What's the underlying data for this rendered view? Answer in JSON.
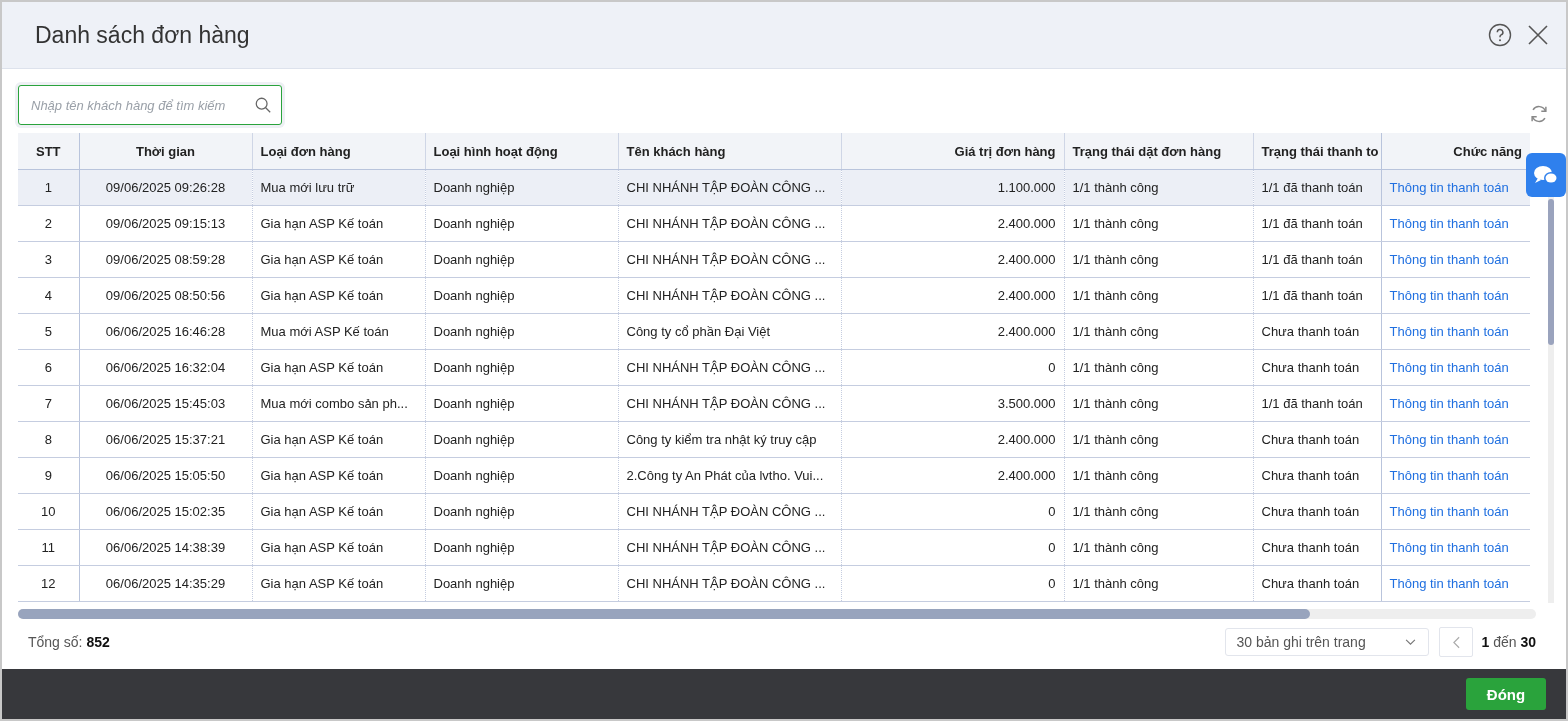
{
  "dialog": {
    "title": "Danh sách đơn hàng"
  },
  "search": {
    "placeholder": "Nhập tên khách hàng để tìm kiếm"
  },
  "table": {
    "columns": [
      "STT",
      "Thời gian",
      "Loại đơn hàng",
      "Loại hình hoạt động",
      "Tên khách hàng",
      "Giá trị đơn hàng",
      "Trạng thái dặt đơn hàng",
      "Trạng thái thanh to",
      "Chức năng"
    ],
    "rows": [
      {
        "selected": true,
        "cells": [
          "1",
          "09/06/2025 09:26:28",
          "Mua mới lưu trữ",
          "Doanh nghiệp",
          "CHI NHÁNH TẬP ĐOÀN CÔNG ...",
          "1.100.000",
          "1/1 thành công",
          "1/1 đã thanh toán",
          "Thông tin thanh toán"
        ]
      },
      {
        "selected": false,
        "cells": [
          "2",
          "09/06/2025 09:15:13",
          "Gia hạn ASP Kế toán",
          "Doanh nghiệp",
          "CHI NHÁNH TẬP ĐOÀN CÔNG ...",
          "2.400.000",
          "1/1 thành công",
          "1/1 đã thanh toán",
          "Thông tin thanh toán"
        ]
      },
      {
        "selected": false,
        "cells": [
          "3",
          "09/06/2025 08:59:28",
          "Gia hạn ASP Kế toán",
          "Doanh nghiệp",
          "CHI NHÁNH TẬP ĐOÀN CÔNG ...",
          "2.400.000",
          "1/1 thành công",
          "1/1 đã thanh toán",
          "Thông tin thanh toán"
        ]
      },
      {
        "selected": false,
        "cells": [
          "4",
          "09/06/2025 08:50:56",
          "Gia hạn ASP Kế toán",
          "Doanh nghiệp",
          "CHI NHÁNH TẬP ĐOÀN CÔNG ...",
          "2.400.000",
          "1/1 thành công",
          "1/1 đã thanh toán",
          "Thông tin thanh toán"
        ]
      },
      {
        "selected": false,
        "cells": [
          "5",
          "06/06/2025 16:46:28",
          "Mua mới ASP Kế toán",
          "Doanh nghiệp",
          "Công ty cổ phần Đại Việt",
          "2.400.000",
          "1/1 thành công",
          "Chưa thanh toán",
          "Thông tin thanh toán"
        ]
      },
      {
        "selected": false,
        "cells": [
          "6",
          "06/06/2025 16:32:04",
          "Gia hạn ASP Kế toán",
          "Doanh nghiệp",
          "CHI NHÁNH TẬP ĐOÀN CÔNG ...",
          "0",
          "1/1 thành công",
          "Chưa thanh toán",
          "Thông tin thanh toán"
        ]
      },
      {
        "selected": false,
        "cells": [
          "7",
          "06/06/2025 15:45:03",
          "Mua mới combo sản ph...",
          "Doanh nghiệp",
          "CHI NHÁNH TẬP ĐOÀN CÔNG ...",
          "3.500.000",
          "1/1 thành công",
          "1/1 đã thanh toán",
          "Thông tin thanh toán"
        ]
      },
      {
        "selected": false,
        "cells": [
          "8",
          "06/06/2025 15:37:21",
          "Gia hạn ASP Kế toán",
          "Doanh nghiệp",
          "Công ty kiểm tra nhật ký truy cập",
          "2.400.000",
          "1/1 thành công",
          "Chưa thanh toán",
          "Thông tin thanh toán"
        ]
      },
      {
        "selected": false,
        "cells": [
          "9",
          "06/06/2025 15:05:50",
          "Gia hạn ASP Kế toán",
          "Doanh nghiệp",
          "2.Công ty An Phát của lvtho. Vui...",
          "2.400.000",
          "1/1 thành công",
          "Chưa thanh toán",
          "Thông tin thanh toán"
        ]
      },
      {
        "selected": false,
        "cells": [
          "10",
          "06/06/2025 15:02:35",
          "Gia hạn ASP Kế toán",
          "Doanh nghiệp",
          "CHI NHÁNH TẬP ĐOÀN CÔNG ...",
          "0",
          "1/1 thành công",
          "Chưa thanh toán",
          "Thông tin thanh toán"
        ]
      },
      {
        "selected": false,
        "cells": [
          "11",
          "06/06/2025 14:38:39",
          "Gia hạn ASP Kế toán",
          "Doanh nghiệp",
          "CHI NHÁNH TẬP ĐOÀN CÔNG ...",
          "0",
          "1/1 thành công",
          "Chưa thanh toán",
          "Thông tin thanh toán"
        ]
      },
      {
        "selected": false,
        "cells": [
          "12",
          "06/06/2025 14:35:29",
          "Gia hạn ASP Kế toán",
          "Doanh nghiệp",
          "CHI NHÁNH TẬP ĐOÀN CÔNG ...",
          "0",
          "1/1 thành công",
          "Chưa thanh toán",
          "Thông tin thanh toán"
        ]
      }
    ]
  },
  "footer": {
    "total_label": "Tổng số:",
    "total_value": "852",
    "page_size": "30 bản ghi trên trang",
    "range_start": "1",
    "range_word": "đến",
    "range_end": "30"
  },
  "buttons": [
    "Đóng"
  ]
}
